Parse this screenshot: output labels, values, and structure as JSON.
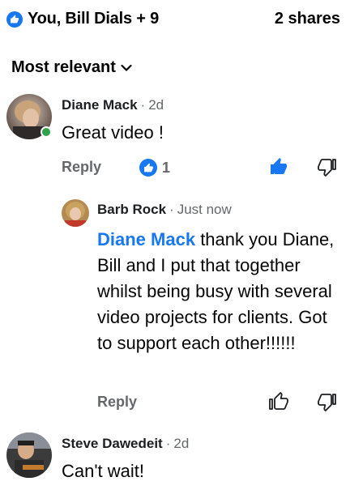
{
  "header": {
    "reactions_text": "You, Bill Dials + 9",
    "shares_text": "2 shares",
    "reaction_icon": "like-icon"
  },
  "sort": {
    "label": "Most relevant",
    "icon": "chevron-down-icon"
  },
  "comments": [
    {
      "author": "Diane Mack",
      "time": "2d",
      "text": "Great video !",
      "reply_label": "Reply",
      "reaction_count": "1",
      "online": true,
      "liked": true,
      "replies": [
        {
          "author": "Barb Rock",
          "time": "Just now",
          "mention": "Diane Mack",
          "text": "thank you Diane, Bill and I put that together whilst being busy with several video projects for clients. Got to support each other!!!!!!",
          "reply_label": "Reply",
          "liked": false
        }
      ]
    },
    {
      "author": "Steve Dawedeit",
      "time": "2d",
      "text": "Can't wait!"
    }
  ],
  "colors": {
    "accent": "#1877f2",
    "secondary_text": "#65676b",
    "online": "#31a24c"
  }
}
